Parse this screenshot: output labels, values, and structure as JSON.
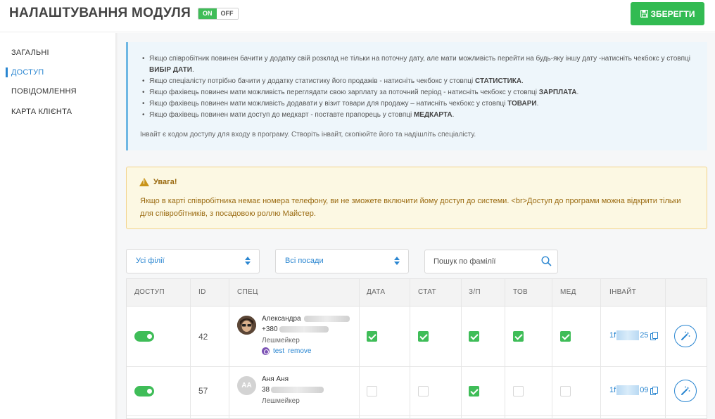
{
  "header": {
    "title": "НАЛАШТУВАННЯ МОДУЛЯ",
    "toggle_on": "ON",
    "toggle_off": "OFF",
    "save_label": "ЗБЕРЕГТИ"
  },
  "sidebar": {
    "items": [
      {
        "label": "ЗАГАЛЬНІ",
        "active": false
      },
      {
        "label": "ДОСТУП",
        "active": true
      },
      {
        "label": "ПОВІДОМЛЕННЯ",
        "active": false
      },
      {
        "label": "КАРТА КЛІЄНТА",
        "active": false
      }
    ]
  },
  "info": {
    "items": [
      {
        "text": "Якщо співробітник повинен бачити у додатку свій розклад не тільки на поточну дату, але мати можливість перейти на будь-яку іншу дату -натисніть чекбокс у стовпці ",
        "bold": "ВИБІР ДАТИ",
        "tail": "."
      },
      {
        "text": "Якщо спеціалісту потрібно бачити у додатку статистику його продажів - натисніть чекбокс у стовпці ",
        "bold": "СТАТИСТИКА",
        "tail": "."
      },
      {
        "text": "Якщо фахівець повинен мати можливість переглядати свою зарплату за поточний період - натисніть чекбокс у стовпці ",
        "bold": "ЗАРПЛАТА",
        "tail": "."
      },
      {
        "text": "Якщо фахівець повинен мати можливість додавати у візит товари для продажу – натисніть чекбокс у стовпці ",
        "bold": "ТОВАРИ",
        "tail": "."
      },
      {
        "text": "Якщо фахівець повинен мати доступ до медкарт - поставте прапорець у стовпці ",
        "bold": "МЕДКАРТА",
        "tail": "."
      }
    ],
    "invite_note": "Інвайт є кодом доступу для входу в програму. Створіть інвайт, скопіюйте його та надішліть спеціалісту."
  },
  "warning": {
    "title": "Увага!",
    "text": "Якщо в карті співробітника немає номера телефону, ви не зможете включити йому доступ до системи. <br>Доступ до програми можна відкрити тільки для співробітників, з посадовою роллю Майстер."
  },
  "filters": {
    "branch": "Усі філії",
    "position": "Всі посади",
    "search_placeholder": "Пошук по фамілії"
  },
  "table": {
    "headers": {
      "access": "ДОСТУП",
      "id": "ID",
      "spec": "СПЕЦ",
      "date": "ДАТА",
      "stat": "СТАТ",
      "salary": "З/П",
      "goods": "ТОВ",
      "med": "МЕД",
      "invite": "ІНВАЙТ"
    },
    "rows": [
      {
        "access": true,
        "id": "42",
        "name": "Александра",
        "phone": "+380",
        "role": "Лешмейкер",
        "link_test": "test",
        "link_remove": "remove",
        "date": true,
        "stat": true,
        "salary": true,
        "goods": true,
        "med": true,
        "invite_start": "1f",
        "invite_end": "25"
      },
      {
        "access": true,
        "id": "57",
        "initials": "АА",
        "name": "Аня Аня",
        "phone": "38",
        "role": "Лешмейкер",
        "date": false,
        "stat": false,
        "salary": true,
        "goods": false,
        "med": false,
        "invite_start": "1f",
        "invite_end": "09"
      }
    ]
  }
}
